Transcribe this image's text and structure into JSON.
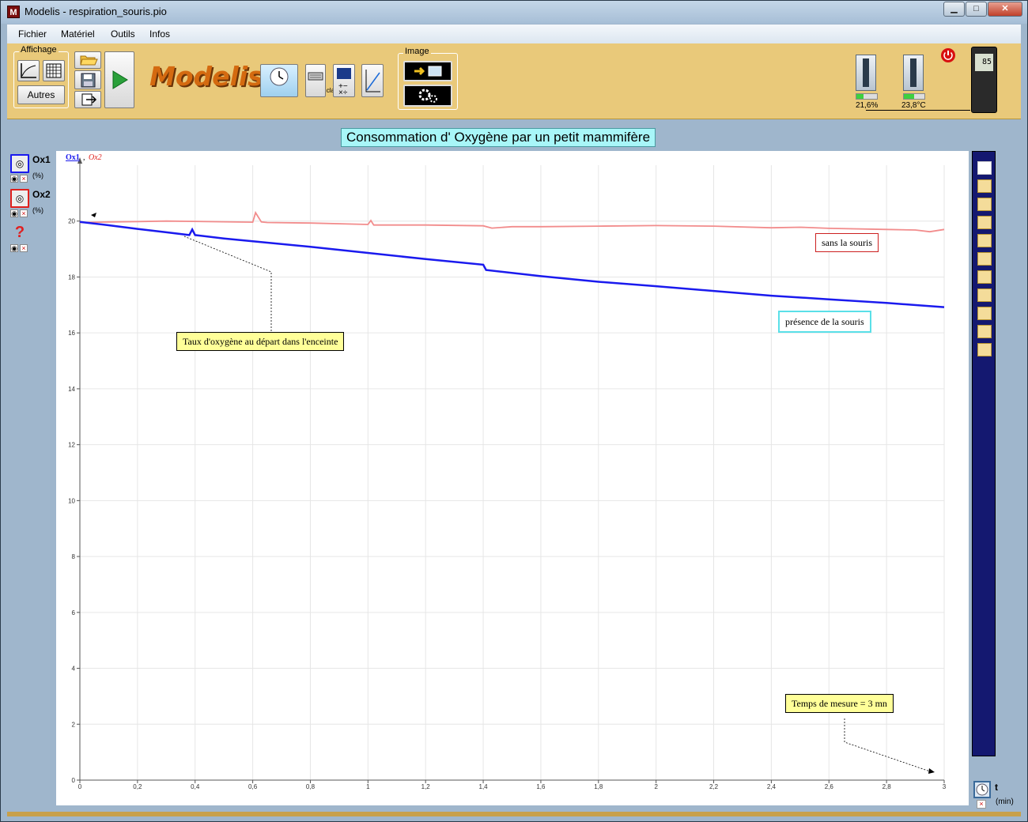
{
  "window": {
    "title": "Modelis - respiration_souris.pio",
    "app_icon": "M",
    "controls": {
      "minimize": "▁",
      "maximize": "□",
      "close": "✕"
    }
  },
  "menu": [
    "Fichier",
    "Matériel",
    "Outils",
    "Infos"
  ],
  "toolbar": {
    "affichage_label": "Affichage",
    "autres_label": "Autres",
    "brand": "Modelis",
    "temps_label": "temps",
    "clavie_label": "clavie",
    "image_label": "Image",
    "sensor1_value": "21,6%",
    "sensor2_value": "23,8°C",
    "sensor1_level": 0.35,
    "sensor2_level": 0.5,
    "device_display": "85"
  },
  "graph_title": "Consommation d' Oxygène par un petit mammifère",
  "channels": [
    {
      "name": "Ox1",
      "unit": "(%)",
      "color": "#1a1aee"
    },
    {
      "name": "Ox2",
      "unit": "(%)",
      "color": "#e0201c"
    },
    {
      "name": "?",
      "unit": ""
    }
  ],
  "time_axis": {
    "symbol": "t",
    "unit": "(min)"
  },
  "annotations": {
    "start": "Taux d'oxygène au départ dans l'enceinte",
    "sans": "sans la souris",
    "presence": "présence de la souris",
    "duration": "Temps de mesure = 3 mn"
  },
  "chart_data": {
    "type": "line",
    "title": "Consommation d' Oxygène par un petit mammifère",
    "legend": [
      "Ox1",
      "Ox2"
    ],
    "xlabel": "t",
    "xunit": "(min)",
    "ylabel": "",
    "xlim": [
      0,
      3
    ],
    "ylim": [
      0,
      22
    ],
    "xticks": [
      "0",
      "0,2",
      "0,4",
      "0,6",
      "0,8",
      "1",
      "1,2",
      "1,4",
      "1,6",
      "1,8",
      "2",
      "2,2",
      "2,4",
      "2,6",
      "2,8",
      "3"
    ],
    "yticks": [
      "0",
      "2",
      "4",
      "6",
      "8",
      "10",
      "12",
      "14",
      "16",
      "18",
      "20"
    ],
    "grid": true,
    "series": [
      {
        "name": "Ox1",
        "color": "#1a1aee",
        "x": [
          0,
          0.1,
          0.2,
          0.3,
          0.38,
          0.39,
          0.4,
          0.5,
          0.6,
          0.8,
          1.0,
          1.2,
          1.4,
          1.41,
          1.6,
          1.8,
          2.0,
          2.2,
          2.4,
          2.6,
          2.8,
          3.0
        ],
        "y": [
          19.97,
          19.85,
          19.72,
          19.6,
          19.5,
          19.7,
          19.5,
          19.38,
          19.28,
          19.08,
          18.86,
          18.64,
          18.44,
          18.25,
          18.03,
          17.83,
          17.67,
          17.5,
          17.33,
          17.2,
          17.07,
          16.92
        ]
      },
      {
        "name": "Ox2",
        "color": "#f28c8c",
        "x": [
          0,
          0.1,
          0.2,
          0.3,
          0.6,
          0.61,
          0.63,
          0.65,
          0.8,
          1.0,
          1.01,
          1.02,
          1.2,
          1.4,
          1.43,
          1.5,
          1.6,
          1.8,
          2.0,
          2.2,
          2.4,
          2.5,
          2.6,
          2.8,
          2.9,
          2.95,
          3.0
        ],
        "y": [
          19.95,
          19.97,
          19.98,
          20.0,
          19.96,
          20.3,
          19.97,
          19.95,
          19.93,
          19.88,
          20.02,
          19.86,
          19.86,
          19.83,
          19.75,
          19.8,
          19.8,
          19.82,
          19.84,
          19.82,
          19.76,
          19.78,
          19.74,
          19.7,
          19.68,
          19.62,
          19.7
        ]
      }
    ]
  }
}
